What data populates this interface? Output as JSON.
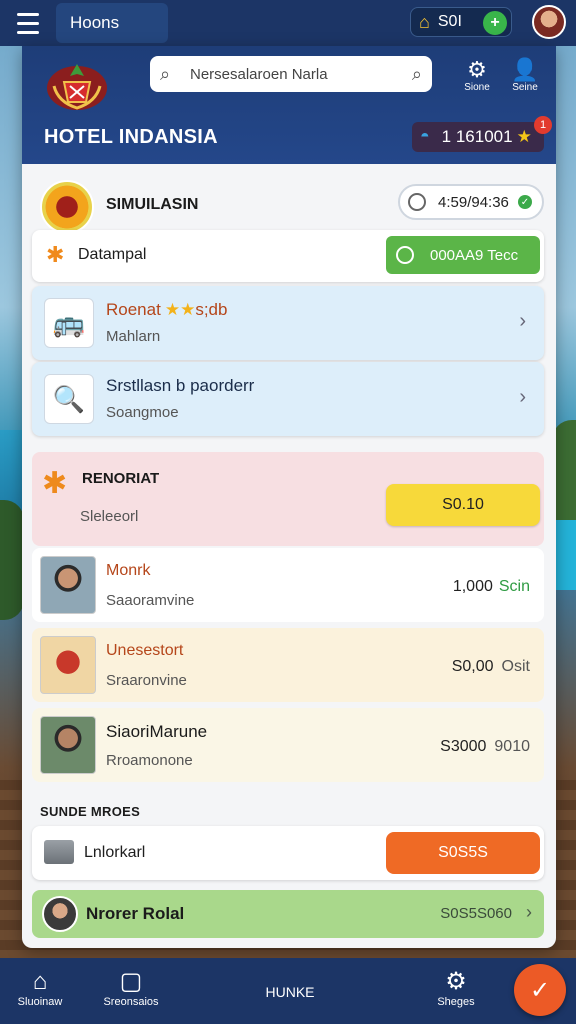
{
  "topbar": {
    "tab_label": "Hoons",
    "currency_value": "S0I",
    "plus": "+"
  },
  "header": {
    "search_placeholder": "Nersesalaroen Narla",
    "btn_settings_label": "Sione",
    "btn_user_label": "Seine",
    "hotel_name": "HOTEL INDANSIA",
    "rating_value": "1 161001",
    "notification_badge": "1"
  },
  "simulasi": {
    "title": "SIMUILASIN",
    "timer": "4:59/94:36"
  },
  "dalampal": {
    "label": "Datampal",
    "button_label": "000AA9 Tecc"
  },
  "items": [
    {
      "title": "Roenat",
      "stars": "★★",
      "suffix": "s;db",
      "sub": "Mahlarn"
    },
    {
      "title": "Srstllasn  b paorderr",
      "sub": "Soangmoe"
    }
  ],
  "reward": {
    "title": "RENORIAT",
    "sub": "Sleleeorl",
    "button_label": "S0.10"
  },
  "list": [
    {
      "title": "Monrk",
      "sub": "Saaoramvine",
      "price": "1,000",
      "extra": "Scin"
    },
    {
      "title": "Unesestort",
      "sub": "Sraaronvine",
      "price": "S0,00",
      "extra": "Osit"
    },
    {
      "title": "SiaoriMarune",
      "sub": "Rroamonone",
      "price": "S3000",
      "extra": "9010"
    }
  ],
  "section_label": "SUNDE MROES",
  "lokal": {
    "label": "Lnlorkarl",
    "button_label": "S0S5S"
  },
  "green_card": {
    "label": "Nrorer Rolal",
    "price": "S0S5S060"
  },
  "bottomnav": {
    "home": "Sluoinaw",
    "search": "Sreonsaios",
    "center": "HUNKE",
    "settings": "Sheges"
  },
  "colors": {
    "navy": "#1c3566",
    "green_btn": "#5bb548",
    "yellow_btn": "#f7d93a",
    "orange_btn": "#ef6a25"
  }
}
